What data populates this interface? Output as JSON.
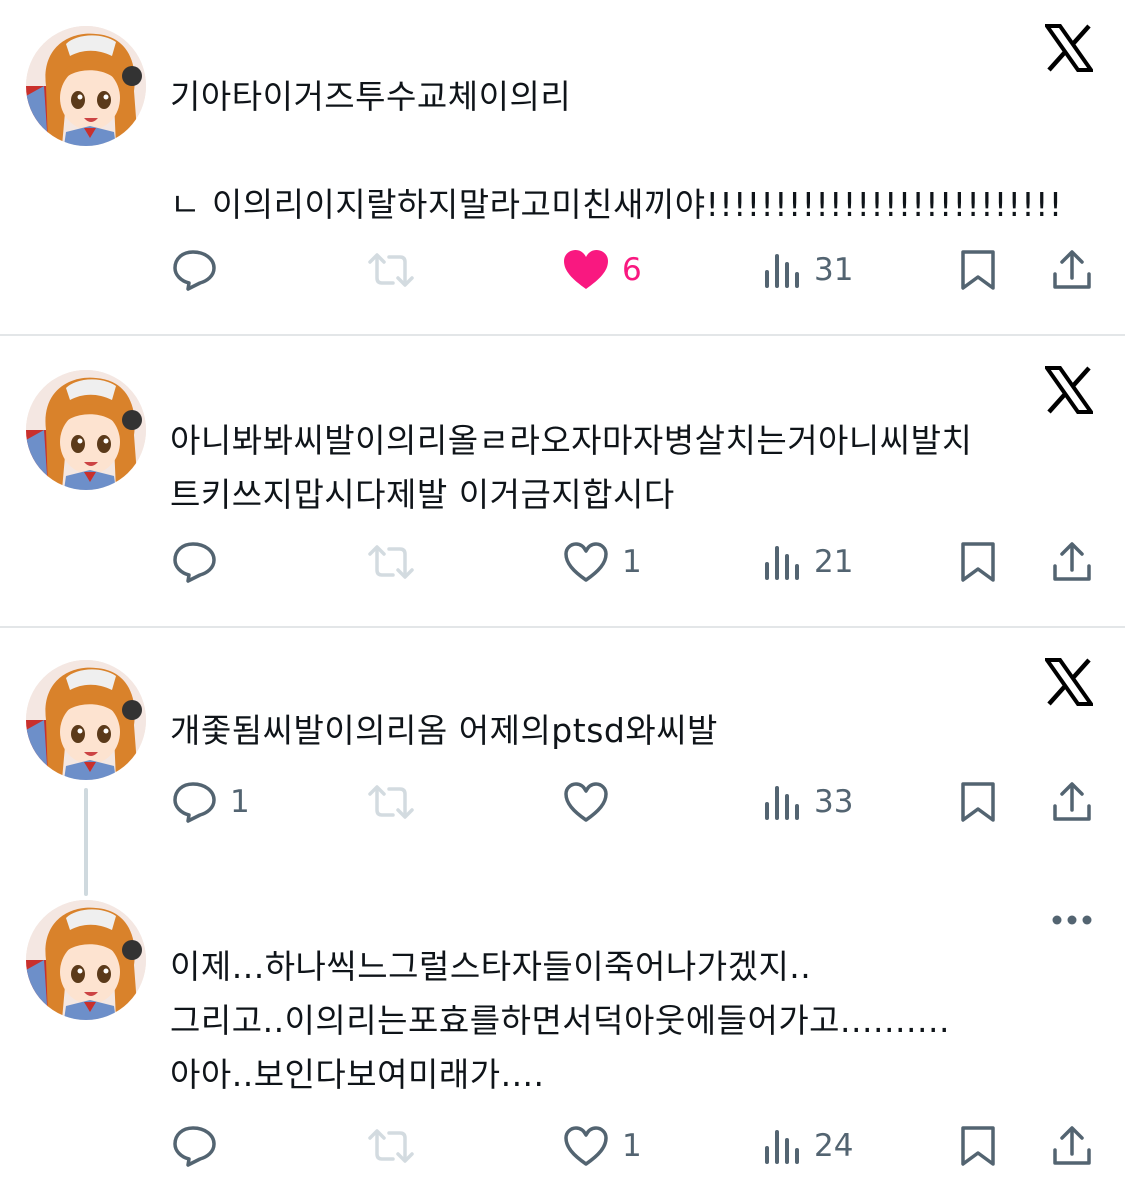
{
  "colors": {
    "text": "#0f1419",
    "muted": "#536471",
    "like": "#f91880",
    "divider": "#e3e6e8",
    "thread": "#cfd9de"
  },
  "posts": [
    {
      "text": "기아타이거즈투수교체이의리\n\nㄴ 이의리이지랄하지말라고미친새끼야!!!!!!!!!!!!!!!!!!!!!!!!!!",
      "corner_icon": "x-logo-icon",
      "reply_count": "",
      "like_count": "6",
      "liked": true,
      "view_count": "31"
    },
    {
      "text": "아니봐봐씨발이의리올ㄹ라오자마자병살치는거아니씨발치\n트키쓰지맙시다제발 이거금지합시다",
      "corner_icon": "x-logo-icon",
      "reply_count": "",
      "like_count": "1",
      "liked": false,
      "view_count": "21"
    },
    {
      "text": "개좇됨씨발이의리옴 어제의ptsd와씨발",
      "corner_icon": "x-logo-icon",
      "reply_count": "1",
      "like_count": "",
      "liked": false,
      "view_count": "33"
    },
    {
      "text": "이제...하나씩느그럴스타자들이죽어나가겠지..\n그리고..이의리는포효를하면서덕아웃에들어가고..........\n아아..보인다보여미래가....",
      "corner_icon": "more-dots-icon",
      "reply_count": "",
      "like_count": "1",
      "liked": false,
      "view_count": "24"
    }
  ]
}
